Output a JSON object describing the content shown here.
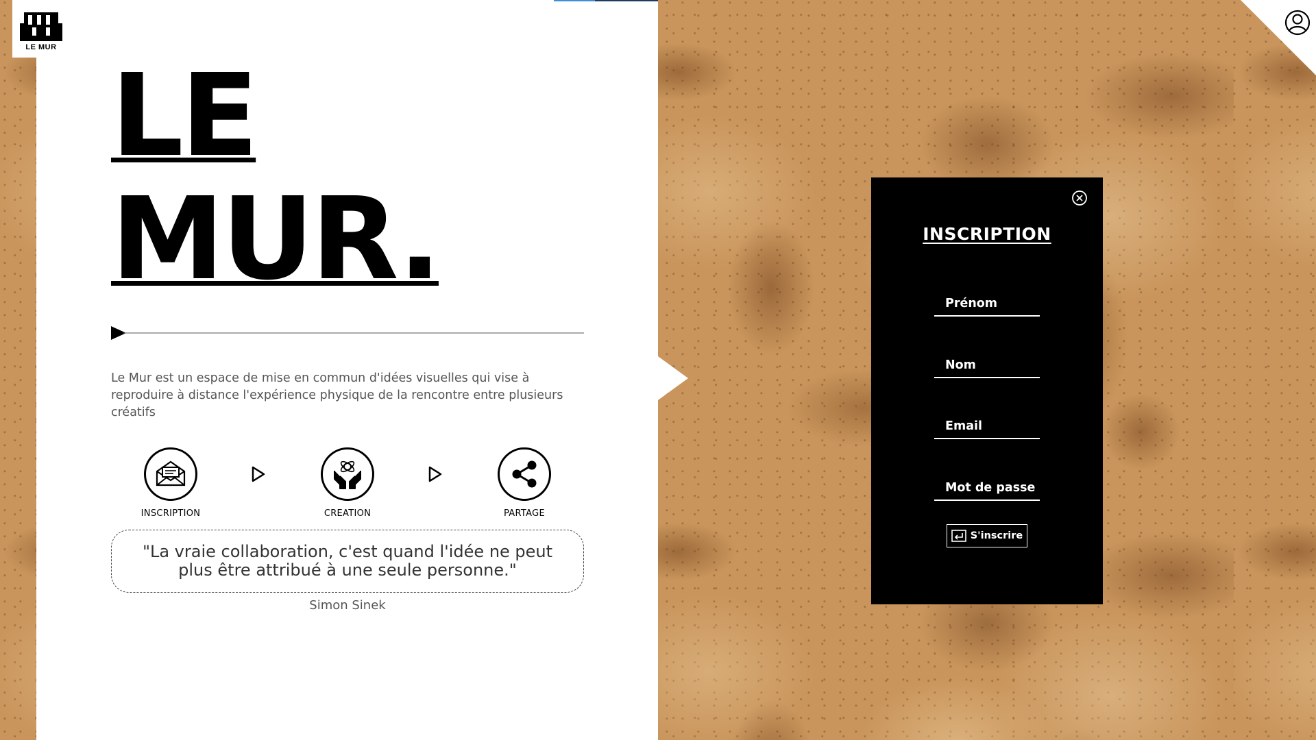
{
  "logo": {
    "icon": "building-wall-icon",
    "label": "LE MUR"
  },
  "header": {
    "account_icon": "user-account-icon"
  },
  "hero": {
    "title_line1": "LE",
    "title_line2": "MUR."
  },
  "intro": {
    "text": "Le Mur est un espace de mise en commun d'idées visuelles qui vise à reproduire à distance l'expérience physique de la rencontre entre plusieurs créatifs"
  },
  "steps": [
    {
      "label": "INSCRIPTION",
      "icon": "envelope-icon"
    },
    {
      "label": "CREATION",
      "icon": "hands-molecule-icon"
    },
    {
      "label": "PARTAGE",
      "icon": "share-icon"
    }
  ],
  "quote": {
    "text": "\"La vraie collaboration, c'est quand l'idée ne peut plus être attribué à une seule personne.\"",
    "author": "Simon Sinek"
  },
  "signup": {
    "title": "INSCRIPTION",
    "fields": {
      "first_name": "Prénom",
      "last_name": "Nom",
      "email": "Email",
      "password": "Mot de passe"
    },
    "submit_label": "S'inscrire"
  },
  "colors": {
    "background_cork": "#c9955c",
    "panel": "#ffffff",
    "card": "#000000",
    "accent_blue": "#3a8fd8"
  }
}
